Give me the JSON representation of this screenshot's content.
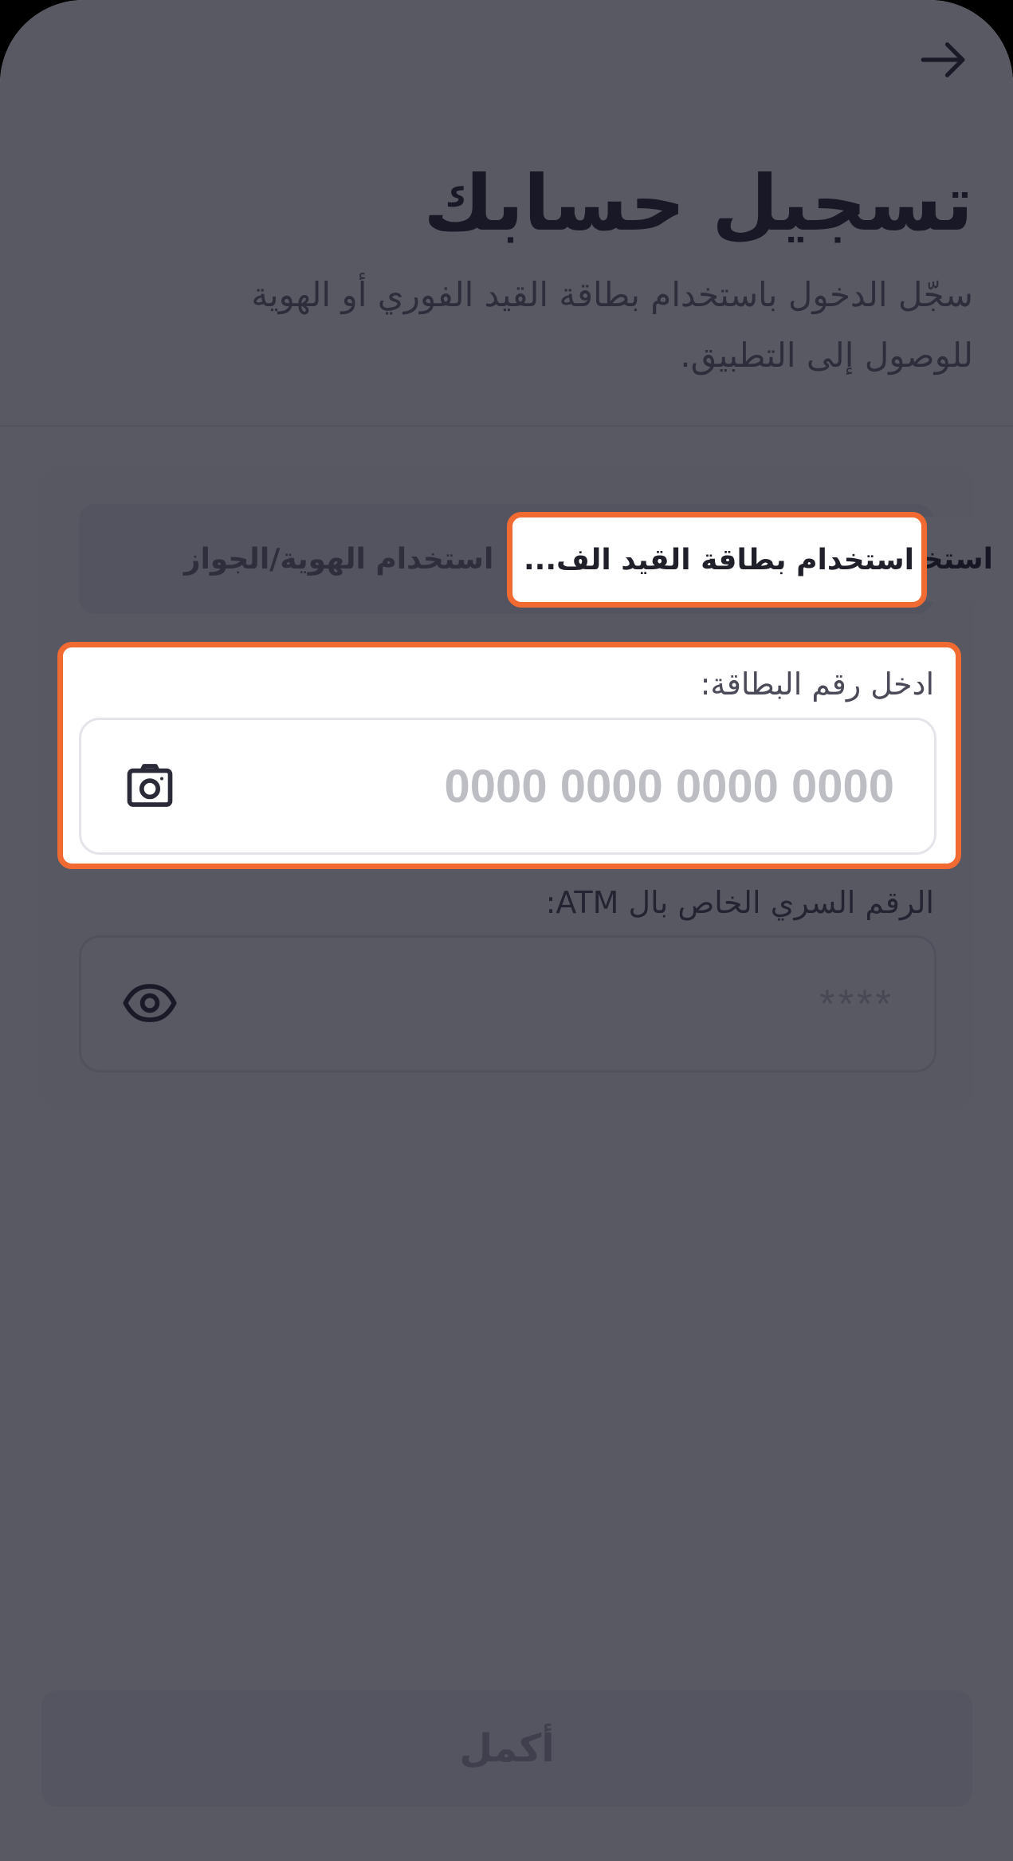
{
  "header": {
    "back_icon": "arrow-right-icon",
    "title": "تسجيل حسابك",
    "subtitle": "سجّل الدخول باستخدام بطاقة القيد الفوري أو الهوية للوصول إلى التطبيق."
  },
  "tabs": {
    "active_label": "استخدام بطاقة القيد الف...",
    "inactive_label": "استخدام الهوية/الجواز"
  },
  "card_field": {
    "label": "ادخل رقم البطاقة:",
    "placeholder": "0000 0000 0000 0000",
    "value": "",
    "icon": "camera-icon"
  },
  "pin_field": {
    "label": "الرقم السري الخاص بال ATM:",
    "placeholder": "****",
    "value": "",
    "icon": "eye-icon"
  },
  "submit": {
    "label": "أكمل"
  },
  "colors": {
    "highlight": "#f06a32",
    "overlay": "#121322",
    "title_text": "#25252f"
  }
}
